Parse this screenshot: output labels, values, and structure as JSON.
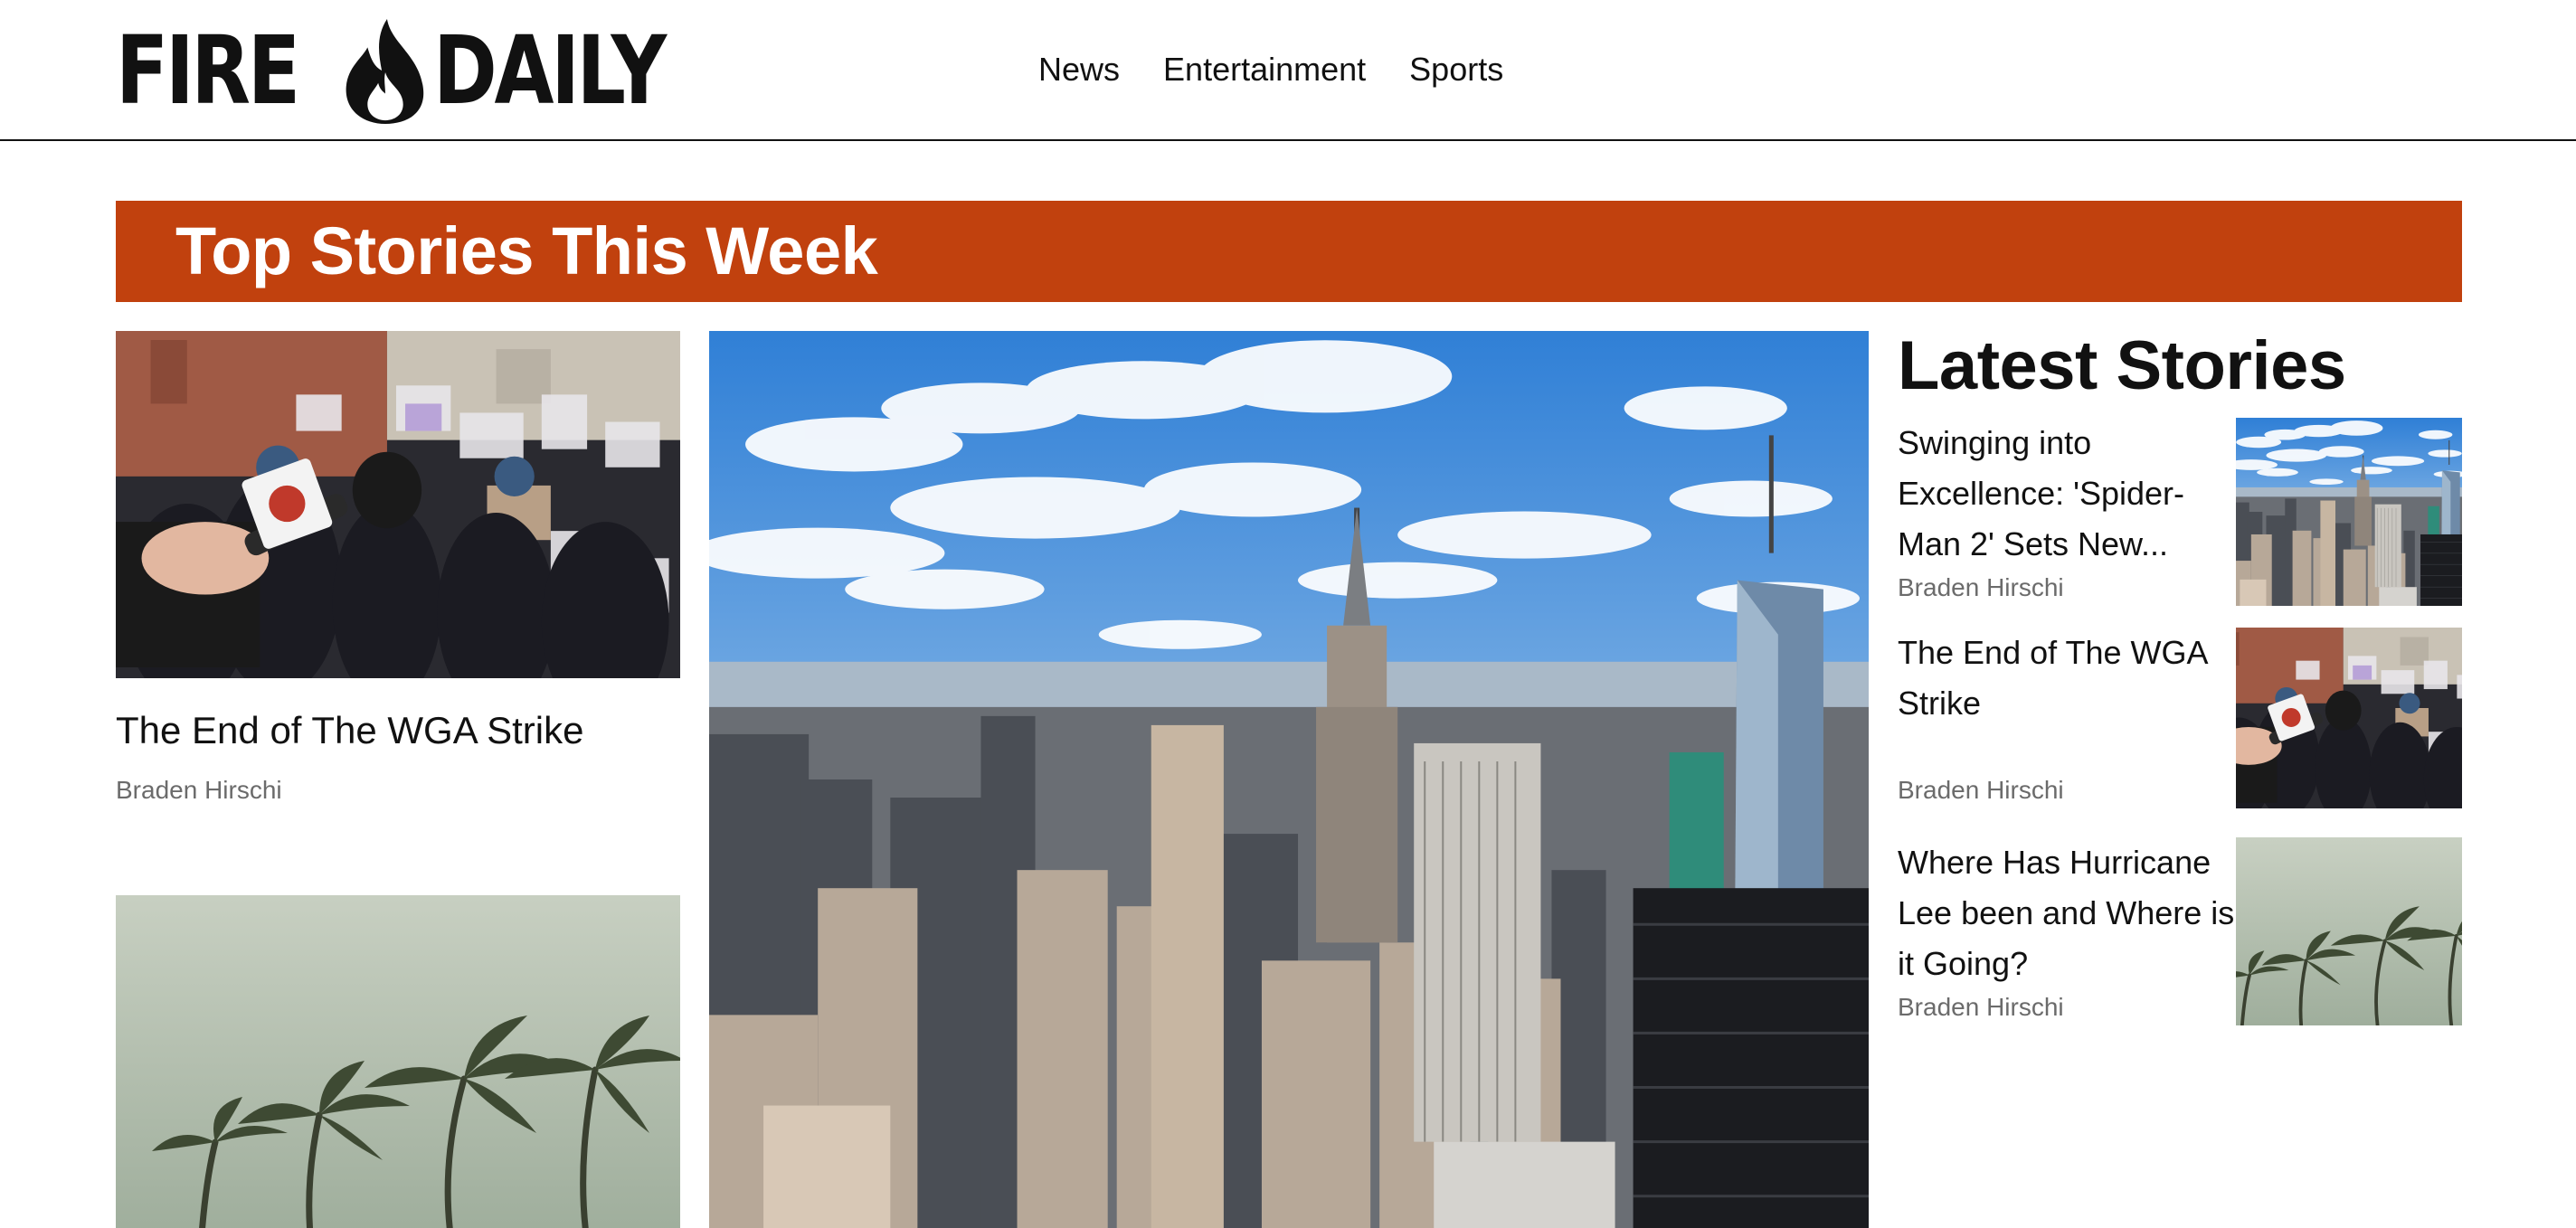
{
  "site": {
    "logo_text_left": "FIRE",
    "logo_text_right": "DAILY",
    "logo_icon": "flame-icon"
  },
  "nav": {
    "items": [
      {
        "label": "News"
      },
      {
        "label": "Entertainment"
      },
      {
        "label": "Sports"
      }
    ]
  },
  "banner": {
    "title": "Top Stories This Week",
    "color": "#c1410e"
  },
  "top_stories": [
    {
      "title": "The End of The WGA Strike",
      "author": "Braden Hirschi",
      "image": "protest-microphone-image"
    },
    {
      "title": "",
      "author": "",
      "image": "palm-trees-storm-image"
    }
  ],
  "featured": {
    "image": "new-york-skyline-image"
  },
  "latest": {
    "heading": "Latest Stories",
    "items": [
      {
        "title": "Swinging into Excellence: 'Spider-Man 2' Sets New...",
        "author": "Braden Hirschi",
        "image": "new-york-skyline-thumbnail"
      },
      {
        "title": "The End of The WGA Strike",
        "author": "Braden Hirschi",
        "image": "protest-microphone-thumbnail"
      },
      {
        "title": "Where Has Hurricane Lee been and Where is it Going?",
        "author": "Braden Hirschi",
        "image": "palm-trees-thumbnail"
      }
    ]
  }
}
